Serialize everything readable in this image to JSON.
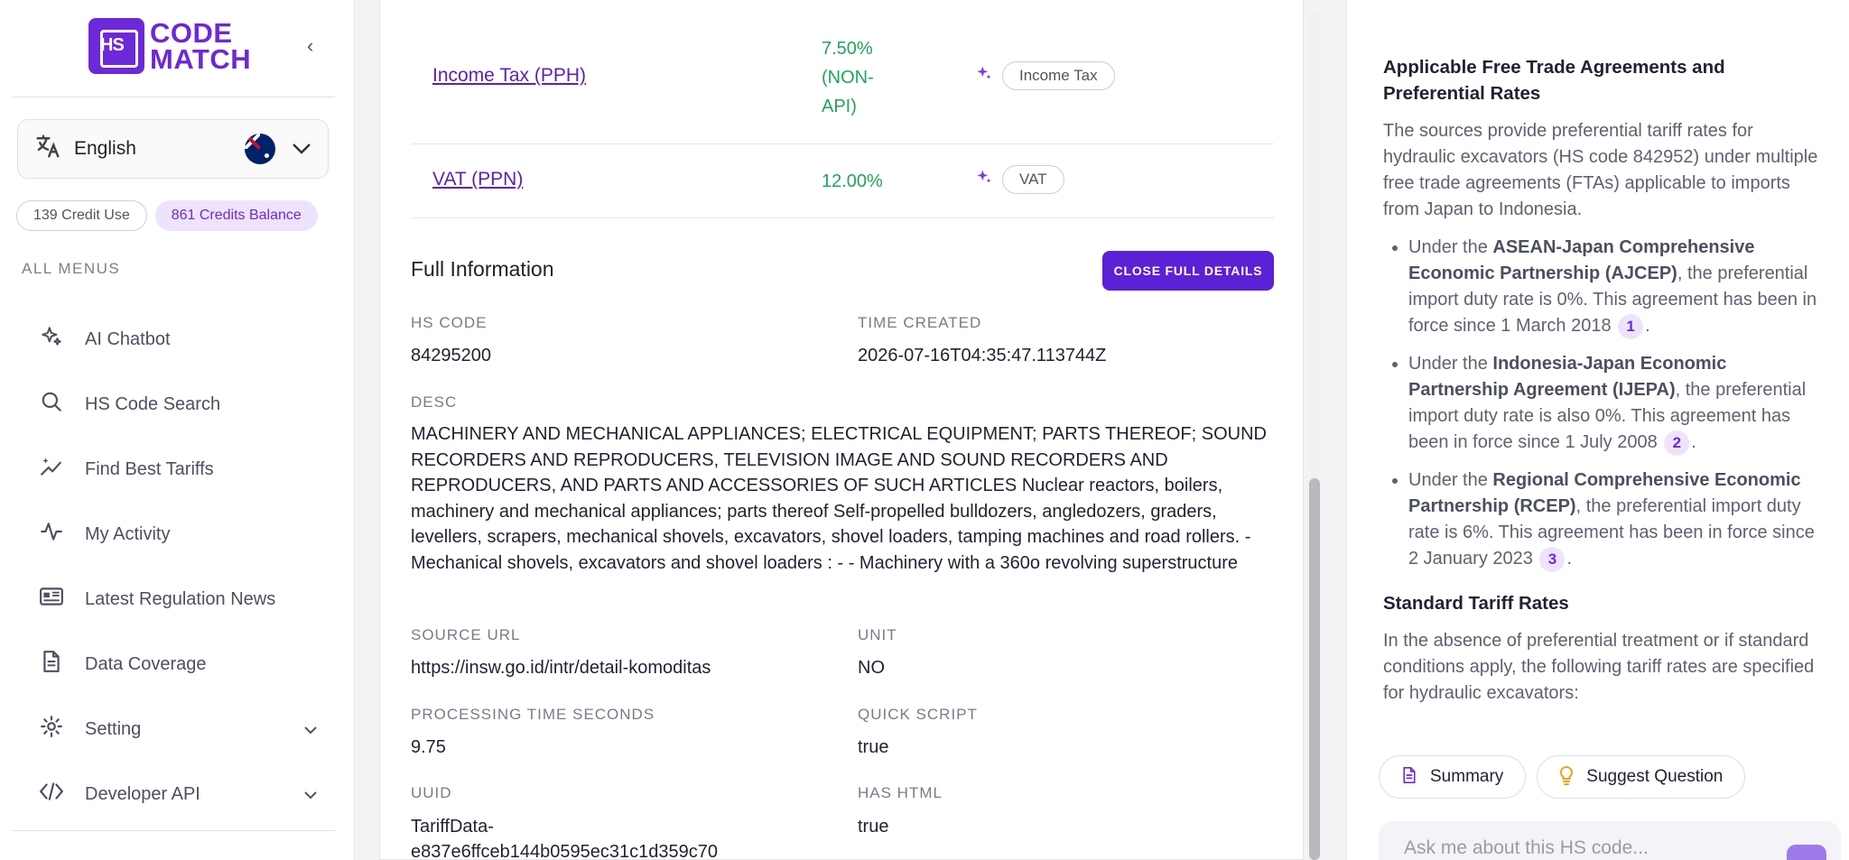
{
  "sidebar": {
    "logo": {
      "hs": "HS",
      "line1": "CODE",
      "line2": "MATCH"
    },
    "language": {
      "label": "English"
    },
    "credits": {
      "use": "139 Credit Use",
      "balance": "861 Credits Balance"
    },
    "menu_header": "ALL MENUS",
    "items": [
      {
        "label": "AI Chatbot",
        "icon": "sparkles-icon"
      },
      {
        "label": "HS Code Search",
        "icon": "search-icon"
      },
      {
        "label": "Find Best Tariffs",
        "icon": "chart-sparkle-icon"
      },
      {
        "label": "My Activity",
        "icon": "activity-icon"
      },
      {
        "label": "Latest Regulation News",
        "icon": "newspaper-icon"
      },
      {
        "label": "Data Coverage",
        "icon": "document-icon"
      },
      {
        "label": "Setting",
        "icon": "gear-icon"
      },
      {
        "label": "Developer API",
        "icon": "code-icon"
      }
    ]
  },
  "taxes": [
    {
      "name": "Income Tax (PPH)",
      "rate": "7.50% (NON-API)",
      "rate_lines": [
        "7.50%",
        "(NON-",
        "API)"
      ],
      "tag": "Income Tax"
    },
    {
      "name": "VAT (PPN)",
      "rate": "12.00%",
      "tag": "VAT"
    }
  ],
  "full_info": {
    "title": "Full Information",
    "close_label": "CLOSE FULL DETAILS",
    "hs_code_label": "HS CODE",
    "hs_code": "84295200",
    "time_created_label": "TIME CREATED",
    "time_created": "2026-07-16T04:35:47.113744Z",
    "desc_label": "DESC",
    "desc": "MACHINERY AND MECHANICAL APPLIANCES; ELECTRICAL EQUIPMENT; PARTS THEREOF; SOUND RECORDERS AND REPRODUCERS, TELEVISION IMAGE AND SOUND RECORDERS AND REPRODUCERS, AND PARTS AND ACCESSORIES OF SUCH ARTICLES Nuclear reactors, boilers, machinery and mechanical appliances; parts thereof Self-propelled bulldozers, angledozers, graders, levellers, scrapers, mechanical shovels, excavators, shovel loaders, tamping machines and road rollers. - Mechanical shovels, excavators and shovel loaders : - - Machinery with a 360o revolving superstructure",
    "source_url_label": "SOURCE URL",
    "source_url": "https://insw.go.id/intr/detail-komoditas",
    "unit_label": "UNIT",
    "unit": "NO",
    "processing_label": "PROCESSING TIME SECONDS",
    "processing": "9.75",
    "quick_script_label": "QUICK SCRIPT",
    "quick_script": "true",
    "uuid_label": "UUID",
    "uuid_line1": "TariffData-",
    "uuid_line2": "e837e6ffceb144b0595ec31c1d359c70",
    "has_html_label": "HAS HTML",
    "has_html": "true"
  },
  "chat": {
    "heading": "Applicable Free Trade Agreements and Preferential Rates",
    "intro": "The sources provide preferential tariff rates for hydraulic excavators (HS code 842952) under multiple free trade agreements (FTAs) applicable to imports from Japan to Indonesia.",
    "bullets": [
      {
        "pre": "Under the ",
        "bold": "ASEAN-Japan Comprehensive Economic Partnership (AJCEP)",
        "post": ", the preferential import duty rate is 0%. This agreement has been in force since 1 March 2018",
        "cite": "1"
      },
      {
        "pre": "Under the ",
        "bold": "Indonesia-Japan Economic Partnership Agreement (IJEPA)",
        "post": ", the preferential import duty rate is also 0%. This agreement has been in force since 1 July 2008",
        "cite": "2"
      },
      {
        "pre": "Under the ",
        "bold": "Regional Comprehensive Economic Partnership (RCEP)",
        "post": ", the preferential import duty rate is 6%. This agreement has been in force since 2 January 2023",
        "cite": "3"
      }
    ],
    "heading2": "Standard Tariff Rates",
    "para2": "In the absence of preferential treatment or if standard conditions apply, the following tariff rates are specified for hydraulic excavators:",
    "summary_label": "Summary",
    "suggest_label": "Suggest Question",
    "ask_placeholder": "Ask me about this HS code..."
  }
}
